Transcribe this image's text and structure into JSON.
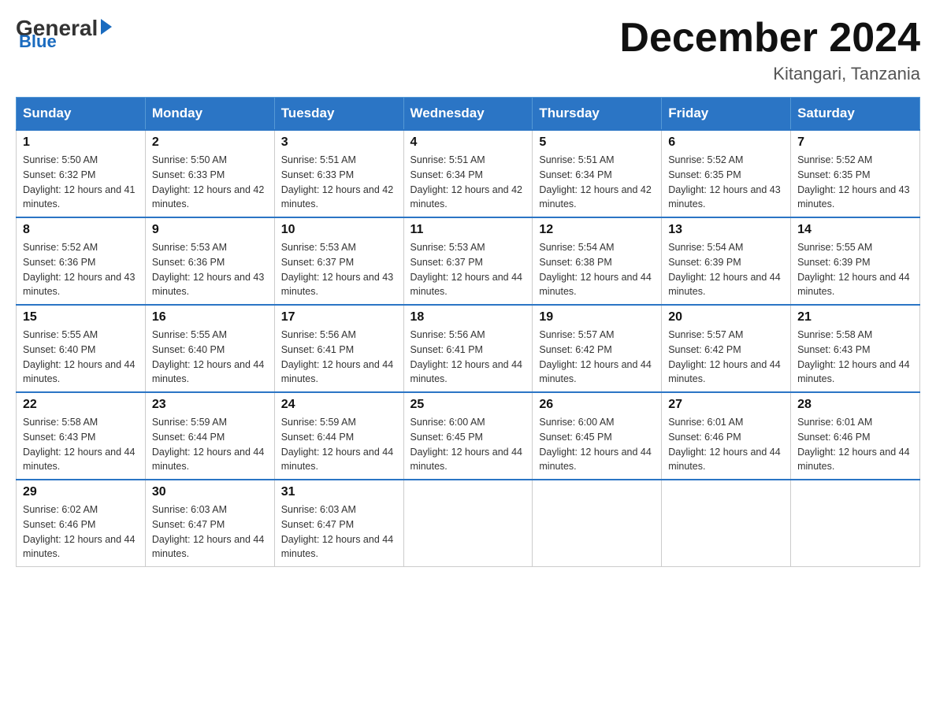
{
  "logo": {
    "general": "General",
    "blue": "Blue"
  },
  "header": {
    "title": "December 2024",
    "location": "Kitangari, Tanzania"
  },
  "days_of_week": [
    "Sunday",
    "Monday",
    "Tuesday",
    "Wednesday",
    "Thursday",
    "Friday",
    "Saturday"
  ],
  "weeks": [
    [
      {
        "day": "1",
        "sunrise": "5:50 AM",
        "sunset": "6:32 PM",
        "daylight": "12 hours and 41 minutes."
      },
      {
        "day": "2",
        "sunrise": "5:50 AM",
        "sunset": "6:33 PM",
        "daylight": "12 hours and 42 minutes."
      },
      {
        "day": "3",
        "sunrise": "5:51 AM",
        "sunset": "6:33 PM",
        "daylight": "12 hours and 42 minutes."
      },
      {
        "day": "4",
        "sunrise": "5:51 AM",
        "sunset": "6:34 PM",
        "daylight": "12 hours and 42 minutes."
      },
      {
        "day": "5",
        "sunrise": "5:51 AM",
        "sunset": "6:34 PM",
        "daylight": "12 hours and 42 minutes."
      },
      {
        "day": "6",
        "sunrise": "5:52 AM",
        "sunset": "6:35 PM",
        "daylight": "12 hours and 43 minutes."
      },
      {
        "day": "7",
        "sunrise": "5:52 AM",
        "sunset": "6:35 PM",
        "daylight": "12 hours and 43 minutes."
      }
    ],
    [
      {
        "day": "8",
        "sunrise": "5:52 AM",
        "sunset": "6:36 PM",
        "daylight": "12 hours and 43 minutes."
      },
      {
        "day": "9",
        "sunrise": "5:53 AM",
        "sunset": "6:36 PM",
        "daylight": "12 hours and 43 minutes."
      },
      {
        "day": "10",
        "sunrise": "5:53 AM",
        "sunset": "6:37 PM",
        "daylight": "12 hours and 43 minutes."
      },
      {
        "day": "11",
        "sunrise": "5:53 AM",
        "sunset": "6:37 PM",
        "daylight": "12 hours and 44 minutes."
      },
      {
        "day": "12",
        "sunrise": "5:54 AM",
        "sunset": "6:38 PM",
        "daylight": "12 hours and 44 minutes."
      },
      {
        "day": "13",
        "sunrise": "5:54 AM",
        "sunset": "6:39 PM",
        "daylight": "12 hours and 44 minutes."
      },
      {
        "day": "14",
        "sunrise": "5:55 AM",
        "sunset": "6:39 PM",
        "daylight": "12 hours and 44 minutes."
      }
    ],
    [
      {
        "day": "15",
        "sunrise": "5:55 AM",
        "sunset": "6:40 PM",
        "daylight": "12 hours and 44 minutes."
      },
      {
        "day": "16",
        "sunrise": "5:55 AM",
        "sunset": "6:40 PM",
        "daylight": "12 hours and 44 minutes."
      },
      {
        "day": "17",
        "sunrise": "5:56 AM",
        "sunset": "6:41 PM",
        "daylight": "12 hours and 44 minutes."
      },
      {
        "day": "18",
        "sunrise": "5:56 AM",
        "sunset": "6:41 PM",
        "daylight": "12 hours and 44 minutes."
      },
      {
        "day": "19",
        "sunrise": "5:57 AM",
        "sunset": "6:42 PM",
        "daylight": "12 hours and 44 minutes."
      },
      {
        "day": "20",
        "sunrise": "5:57 AM",
        "sunset": "6:42 PM",
        "daylight": "12 hours and 44 minutes."
      },
      {
        "day": "21",
        "sunrise": "5:58 AM",
        "sunset": "6:43 PM",
        "daylight": "12 hours and 44 minutes."
      }
    ],
    [
      {
        "day": "22",
        "sunrise": "5:58 AM",
        "sunset": "6:43 PM",
        "daylight": "12 hours and 44 minutes."
      },
      {
        "day": "23",
        "sunrise": "5:59 AM",
        "sunset": "6:44 PM",
        "daylight": "12 hours and 44 minutes."
      },
      {
        "day": "24",
        "sunrise": "5:59 AM",
        "sunset": "6:44 PM",
        "daylight": "12 hours and 44 minutes."
      },
      {
        "day": "25",
        "sunrise": "6:00 AM",
        "sunset": "6:45 PM",
        "daylight": "12 hours and 44 minutes."
      },
      {
        "day": "26",
        "sunrise": "6:00 AM",
        "sunset": "6:45 PM",
        "daylight": "12 hours and 44 minutes."
      },
      {
        "day": "27",
        "sunrise": "6:01 AM",
        "sunset": "6:46 PM",
        "daylight": "12 hours and 44 minutes."
      },
      {
        "day": "28",
        "sunrise": "6:01 AM",
        "sunset": "6:46 PM",
        "daylight": "12 hours and 44 minutes."
      }
    ],
    [
      {
        "day": "29",
        "sunrise": "6:02 AM",
        "sunset": "6:46 PM",
        "daylight": "12 hours and 44 minutes."
      },
      {
        "day": "30",
        "sunrise": "6:03 AM",
        "sunset": "6:47 PM",
        "daylight": "12 hours and 44 minutes."
      },
      {
        "day": "31",
        "sunrise": "6:03 AM",
        "sunset": "6:47 PM",
        "daylight": "12 hours and 44 minutes."
      },
      null,
      null,
      null,
      null
    ]
  ]
}
